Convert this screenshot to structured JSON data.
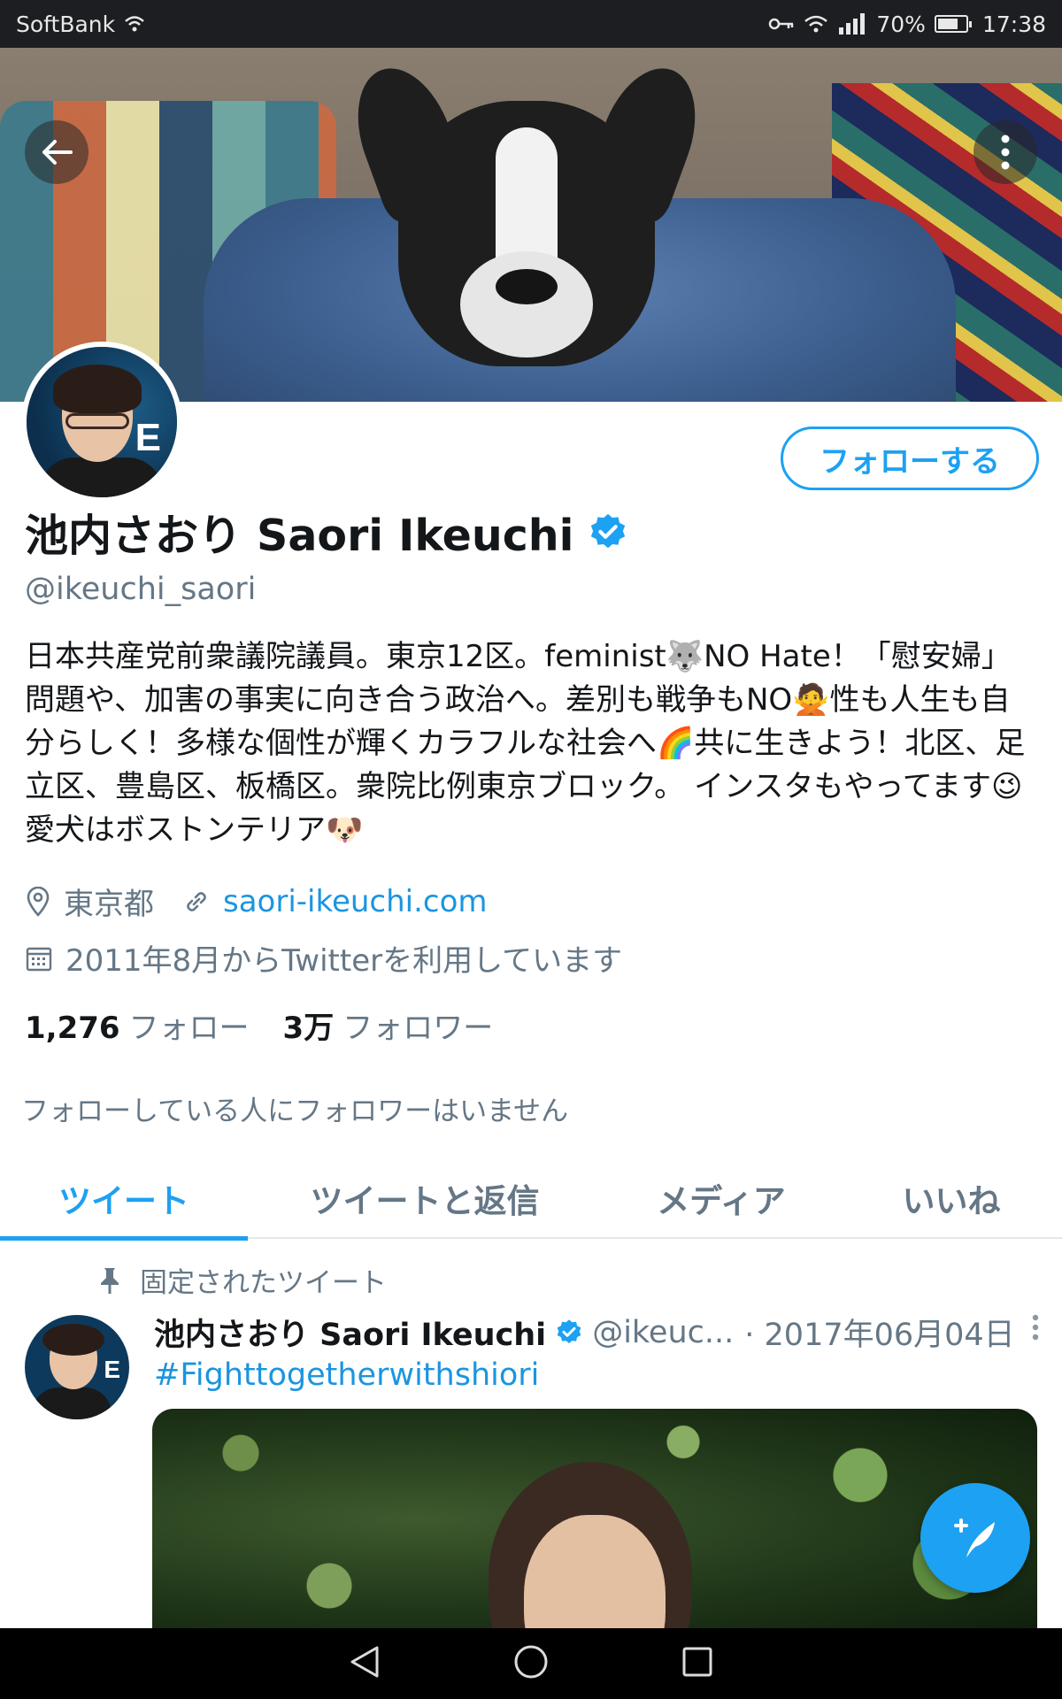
{
  "status_bar": {
    "carrier": "SoftBank",
    "battery": "70%",
    "time": "17:38"
  },
  "profile": {
    "name": "池内さおり Saori Ikeuchi",
    "handle": "@ikeuchi_saori",
    "follow_label": "フォローする",
    "bio": "日本共産党前衆議院議員。東京12区。feminist🐺NO Hate！「慰安婦」問題や、加害の事実に向き合う政治へ。差別も戦争もNO🙅性も人生も自分らしく！多様な個性が輝くカラフルな社会へ🌈共に生きよう！北区、足立区、豊島区、板橋区。衆院比例東京ブロック。 インスタもやってます😉愛犬はボストンテリア🐶",
    "location": "東京都",
    "website": "saori-ikeuchi.com",
    "joined": "2011年8月からTwitterを利用しています",
    "following_count": "1,276",
    "following_label": "フォロー",
    "followers_count": "3万",
    "followers_label": "フォロワー",
    "followers_you_know": "フォローしている人にフォロワーはいません",
    "avatar_letter": "E"
  },
  "tabs": [
    "ツイート",
    "ツイートと返信",
    "メディア",
    "いいね"
  ],
  "active_tab": 0,
  "tweet": {
    "pinned_label": "固定されたツイート",
    "author_name": "池内さおり Saori Ikeuchi",
    "author_handle": "@ikeuc...",
    "date": "· 2017年06月04日",
    "hashtag": "#Fighttogetherwithshiori"
  },
  "colors": {
    "accent": "#1da1f2",
    "link": "#1b95e0",
    "secondary_text": "#657786"
  },
  "icons": {
    "back": "arrow-left-icon",
    "more": "vertical-dots-icon",
    "verified": "verified-badge-icon",
    "location": "location-pin-icon",
    "link": "link-icon",
    "calendar": "calendar-icon",
    "pin": "pin-icon",
    "compose": "compose-tweet-icon"
  }
}
